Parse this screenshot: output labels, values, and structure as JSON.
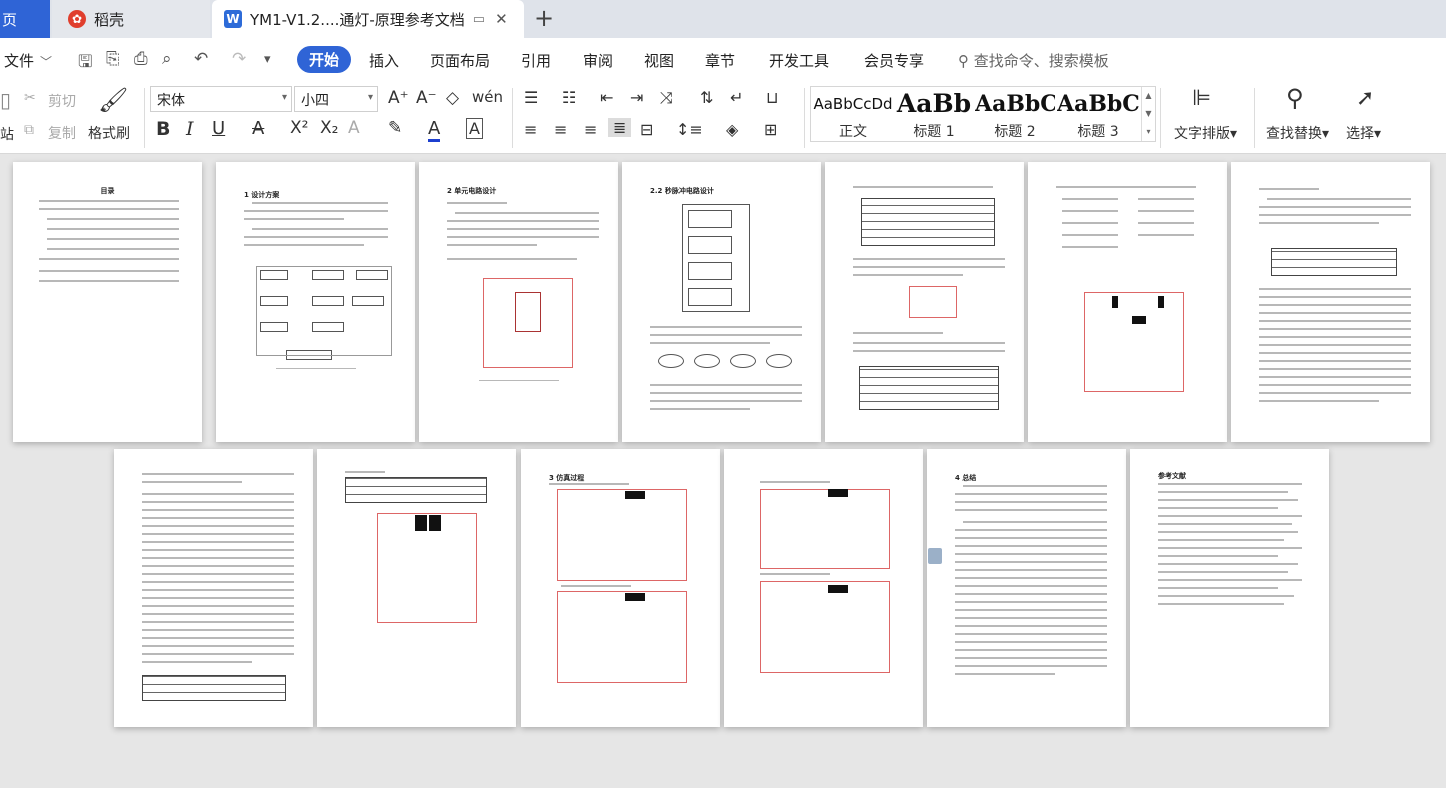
{
  "tabs": {
    "home_label": "页",
    "daoke_label": "稻壳",
    "daoke_icon": "W",
    "doc_icon": "W",
    "doc_title": "YM1-V1.2....通灯-原理参考文档"
  },
  "menu": {
    "file_label": "文件",
    "items": [
      "开始",
      "插入",
      "页面布局",
      "引用",
      "审阅",
      "视图",
      "章节",
      "开发工具",
      "会员专享"
    ],
    "search_placeholder": "查找命令、搜索模板"
  },
  "ribbon": {
    "cut_label": "剪切",
    "copy_label": "复制",
    "paste_label": "粘",
    "paste_label2": "站",
    "format_painter_label": "格式刷",
    "font_name": "宋体",
    "font_size": "小四",
    "styles": [
      {
        "preview": "AaBbCcDd",
        "label": "正文"
      },
      {
        "preview": "AaBb",
        "label": "标题 1"
      },
      {
        "preview": "AaBbC",
        "label": "标题 2"
      },
      {
        "preview": "AaBbC",
        "label": "标题 3"
      }
    ],
    "text_layout_label": "文字排版",
    "find_replace_label": "查找替换",
    "select_label": "选择"
  },
  "pages": {
    "p1_title": "目录",
    "p2_title": "1 设计方案",
    "p3_title": "2 单元电路设计",
    "p4_title": "2.2 秒脉冲电路设计",
    "p9_title": "3 仿真过程",
    "p12_title": "4 总结",
    "p13_title": "参考文献"
  },
  "colors": {
    "accent": "#2f64d6",
    "tab_bar": "#dfe3ea",
    "canvas": "#e6e6e6"
  }
}
